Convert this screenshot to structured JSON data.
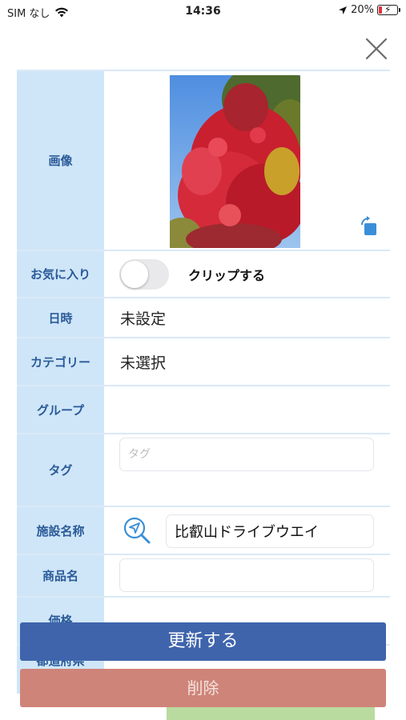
{
  "status_bar": {
    "carrier": "SIM なし",
    "time": "14:36",
    "battery_percent": "20%",
    "battery_level": 0.2,
    "icons": [
      "wifi-icon",
      "location-arrow-icon",
      "battery-charging-icon"
    ]
  },
  "form": {
    "image_label": "画像",
    "favorite_label": "お気に入り",
    "favorite_toggle_on": false,
    "clip_label": "クリップする",
    "datetime_label": "日時",
    "datetime_value": "未設定",
    "category_label": "カテゴリー",
    "category_value": "未選択",
    "group_label": "グループ",
    "group_value": "",
    "tag_label": "タグ",
    "tag_placeholder": "タグ",
    "tag_value": "",
    "facility_label": "施設名称",
    "facility_value": "比叡山ドライブウエイ",
    "product_label": "商品名",
    "product_value": "",
    "price_label_partial": "価格",
    "prefecture_label_partial": "都道府県"
  },
  "actions": {
    "update_label": "更新する",
    "delete_label": "削除"
  },
  "colors": {
    "label_bg": "#cfe6f8",
    "label_text": "#2a5a98",
    "update_button": "#3f64ac",
    "delete_button": "#cf8479",
    "accent_icon": "#3a8fd8"
  }
}
